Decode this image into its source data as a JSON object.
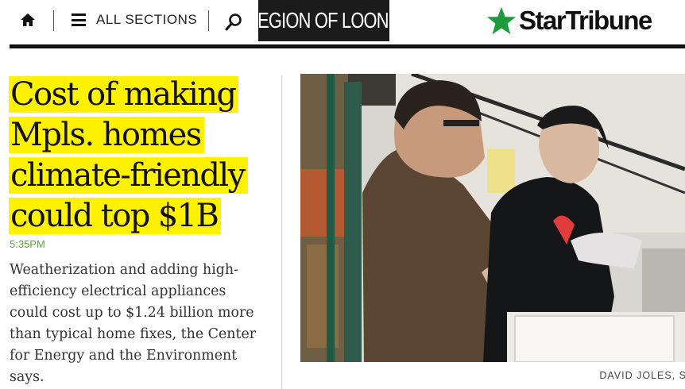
{
  "header": {
    "sections_label": "ALL SECTIONS",
    "promo_label": "LEGION OF LOONS",
    "logo_text": "StarTribune",
    "icons": [
      "home-icon",
      "menu-icon",
      "search-icon",
      "star-icon"
    ],
    "colors": {
      "logo_star": "#1e9b3c",
      "promo_bg": "#1b1b1b"
    }
  },
  "article": {
    "headline": "Cost of making Mpls. homes climate-friendly could top $1B",
    "timestamp": "5:35PM",
    "summary": "Weatherization and adding high-efficiency electrical appliances could cost up to $1.24 billion more than typical home fixes, the Center for Energy and the Environment says.",
    "photo_credit": "DAVID JOLES, S",
    "colors": {
      "highlight": "#fff200",
      "timestamp": "#59a42c"
    }
  }
}
